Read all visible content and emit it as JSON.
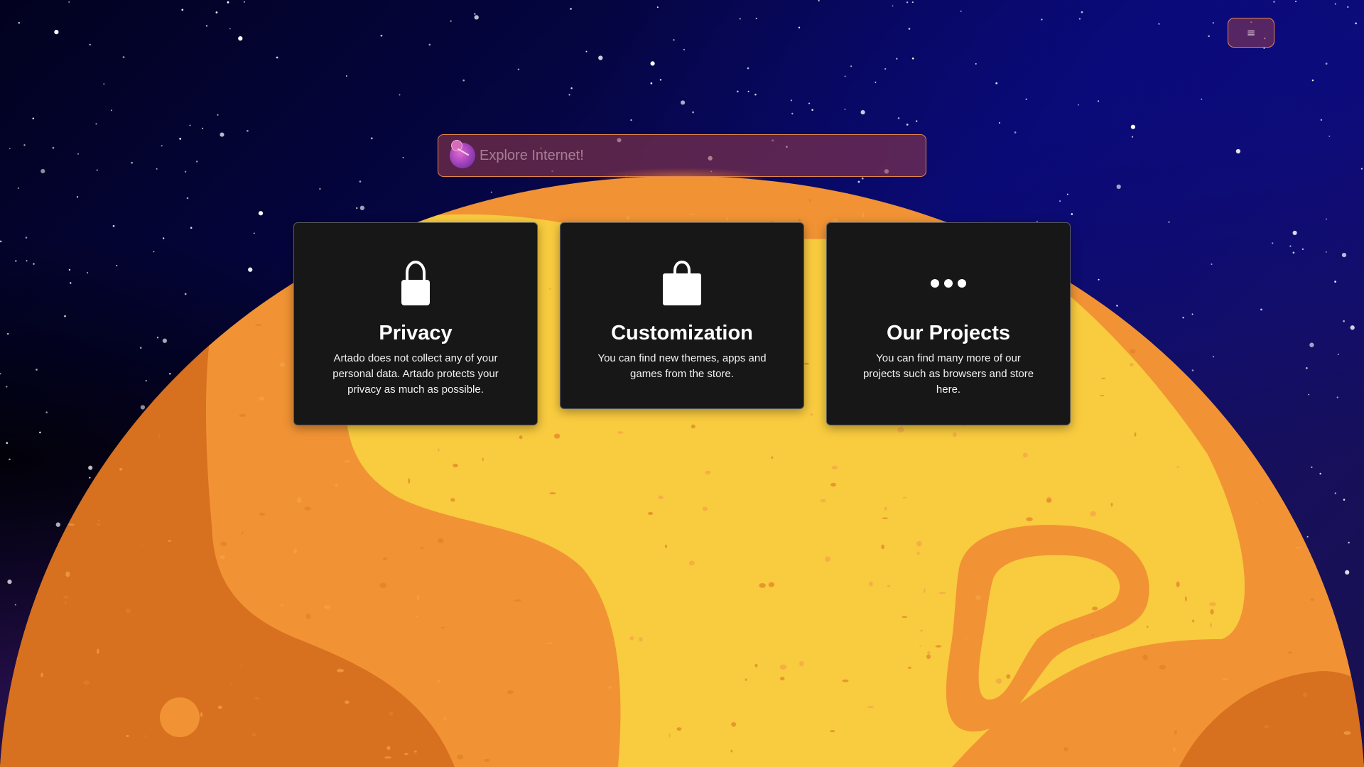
{
  "header": {
    "menu_label": "≡"
  },
  "search": {
    "placeholder": "Explore Internet!",
    "value": ""
  },
  "features": [
    {
      "icon": "lock-icon",
      "title": "Privacy",
      "text": "Artado does not collect any of your personal data. Artado protects your privacy as much as possible."
    },
    {
      "icon": "shopping-bag-icon",
      "title": "Customization",
      "text": "You can find new themes, apps and games from the store."
    },
    {
      "icon": "more-dots-icon",
      "title": "Our Projects",
      "text": "You can find many more of our projects such as browsers and store here."
    }
  ],
  "colors": {
    "sky_dark": "#02021f",
    "sky_blue": "#0a0a6e",
    "planet_orange": "#f19334",
    "planet_dark": "#d7701f",
    "planet_yellow": "#f9cb3f",
    "card_bg": "#171717",
    "accent_border": "#e5864a"
  }
}
